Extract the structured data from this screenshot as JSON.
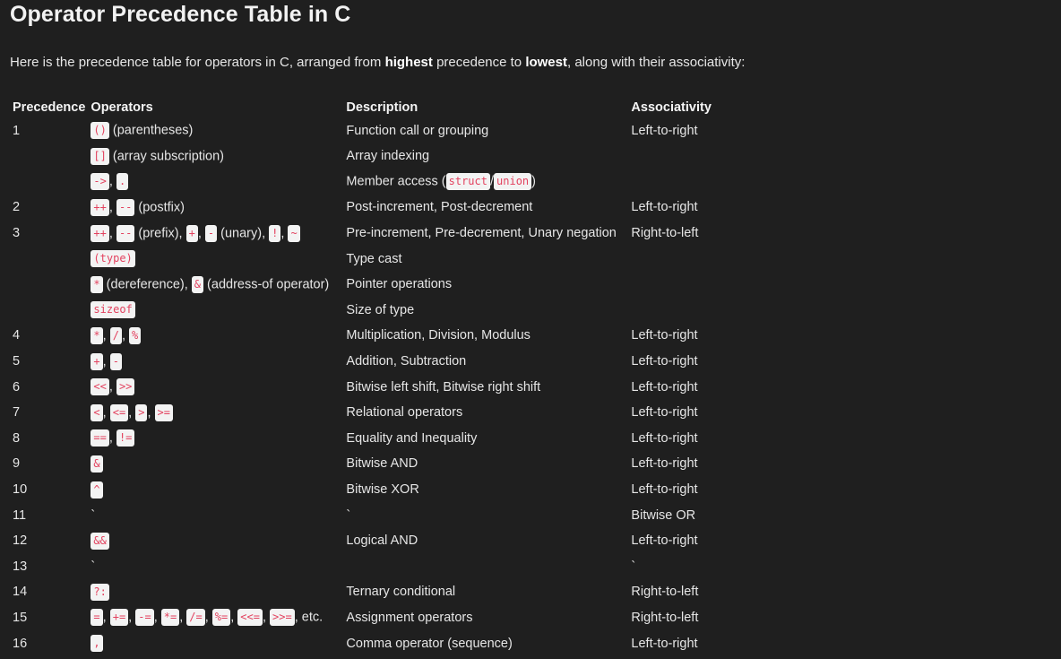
{
  "title": "Operator Precedence Table in C",
  "intro": {
    "before": "Here is the precedence table for operators in C, arranged from ",
    "bold1": "highest",
    "middle": " precedence to ",
    "bold2": "lowest",
    "after": ", along with their associativity:"
  },
  "table": {
    "headers": {
      "precedence": "Precedence",
      "operators": "Operators",
      "description": "Description",
      "associativity": "Associativity"
    },
    "rows": [
      {
        "prec": "1",
        "ops": [
          {
            "code": "()"
          },
          {
            "text": " (parentheses)"
          }
        ],
        "desc": "Function call or grouping",
        "assoc": "Left-to-right"
      },
      {
        "prec": "",
        "ops": [
          {
            "code": "[]"
          },
          {
            "text": " (array subscription)"
          }
        ],
        "desc": "Array indexing",
        "assoc": ""
      },
      {
        "prec": "",
        "ops": [
          {
            "code": "->"
          },
          {
            "text": ", "
          },
          {
            "code": "."
          }
        ],
        "desc": [
          {
            "text": "Member access ("
          },
          {
            "code": "struct"
          },
          {
            "text": "/"
          },
          {
            "code": "union"
          },
          {
            "text": ")"
          }
        ],
        "assoc": ""
      },
      {
        "prec": "2",
        "ops": [
          {
            "code": "++"
          },
          {
            "text": ", "
          },
          {
            "code": "--"
          },
          {
            "text": " (postfix)"
          }
        ],
        "desc": "Post-increment, Post-decrement",
        "assoc": "Left-to-right"
      },
      {
        "prec": "3",
        "ops": [
          {
            "code": "++"
          },
          {
            "text": ", "
          },
          {
            "code": "--"
          },
          {
            "text": " (prefix), "
          },
          {
            "code": "+"
          },
          {
            "text": ", "
          },
          {
            "code": "-"
          },
          {
            "text": " (unary), "
          },
          {
            "code": "!"
          },
          {
            "text": ", "
          },
          {
            "code": "~"
          }
        ],
        "desc": "Pre-increment, Pre-decrement, Unary negation",
        "assoc": "Right-to-left"
      },
      {
        "prec": "",
        "ops": [
          {
            "code": "(type)"
          }
        ],
        "desc": "Type cast",
        "assoc": ""
      },
      {
        "prec": "",
        "ops": [
          {
            "code": "*"
          },
          {
            "text": " (dereference), "
          },
          {
            "code": "&"
          },
          {
            "text": " (address-of operator)"
          }
        ],
        "desc": "Pointer operations",
        "assoc": ""
      },
      {
        "prec": "",
        "ops": [
          {
            "code": "sizeof"
          }
        ],
        "desc": "Size of type",
        "assoc": ""
      },
      {
        "prec": "4",
        "ops": [
          {
            "code": "*"
          },
          {
            "text": ", "
          },
          {
            "code": "/"
          },
          {
            "text": ", "
          },
          {
            "code": "%"
          }
        ],
        "desc": "Multiplication, Division, Modulus",
        "assoc": "Left-to-right"
      },
      {
        "prec": "5",
        "ops": [
          {
            "code": "+"
          },
          {
            "text": ", "
          },
          {
            "code": "-"
          }
        ],
        "desc": "Addition, Subtraction",
        "assoc": "Left-to-right"
      },
      {
        "prec": "6",
        "ops": [
          {
            "code": "<<"
          },
          {
            "text": ", "
          },
          {
            "code": ">>"
          }
        ],
        "desc": "Bitwise left shift, Bitwise right shift",
        "assoc": "Left-to-right"
      },
      {
        "prec": "7",
        "ops": [
          {
            "code": "<"
          },
          {
            "text": ", "
          },
          {
            "code": "<="
          },
          {
            "text": ", "
          },
          {
            "code": ">"
          },
          {
            "text": ", "
          },
          {
            "code": ">="
          }
        ],
        "desc": "Relational operators",
        "assoc": "Left-to-right"
      },
      {
        "prec": "8",
        "ops": [
          {
            "code": "=="
          },
          {
            "text": ", "
          },
          {
            "code": "!="
          }
        ],
        "desc": "Equality and Inequality",
        "assoc": "Left-to-right"
      },
      {
        "prec": "9",
        "ops": [
          {
            "code": "&"
          }
        ],
        "desc": "Bitwise AND",
        "assoc": "Left-to-right"
      },
      {
        "prec": "10",
        "ops": [
          {
            "code": "^"
          }
        ],
        "desc": "Bitwise XOR",
        "assoc": "Left-to-right"
      },
      {
        "prec": "11",
        "ops": [
          {
            "text": "`"
          }
        ],
        "desc": "`",
        "assoc": "Bitwise OR"
      },
      {
        "prec": "12",
        "ops": [
          {
            "code": "&&"
          }
        ],
        "desc": "Logical AND",
        "assoc": "Left-to-right"
      },
      {
        "prec": "13",
        "ops": [
          {
            "text": "`"
          }
        ],
        "desc": "",
        "assoc": "`"
      },
      {
        "prec": "14",
        "ops": [
          {
            "code": "?:"
          }
        ],
        "desc": "Ternary conditional",
        "assoc": "Right-to-left"
      },
      {
        "prec": "15",
        "ops": [
          {
            "code": "="
          },
          {
            "text": ", "
          },
          {
            "code": "+="
          },
          {
            "text": ", "
          },
          {
            "code": "-="
          },
          {
            "text": ", "
          },
          {
            "code": "*="
          },
          {
            "text": ", "
          },
          {
            "code": "/="
          },
          {
            "text": ", "
          },
          {
            "code": "%="
          },
          {
            "text": ", "
          },
          {
            "code": "<<="
          },
          {
            "text": ", "
          },
          {
            "code": ">>="
          },
          {
            "text": ", etc."
          }
        ],
        "desc": "Assignment operators",
        "assoc": "Right-to-left"
      },
      {
        "prec": "16",
        "ops": [
          {
            "code": ","
          }
        ],
        "desc": "Comma operator (sequence)",
        "assoc": "Left-to-right"
      }
    ]
  }
}
